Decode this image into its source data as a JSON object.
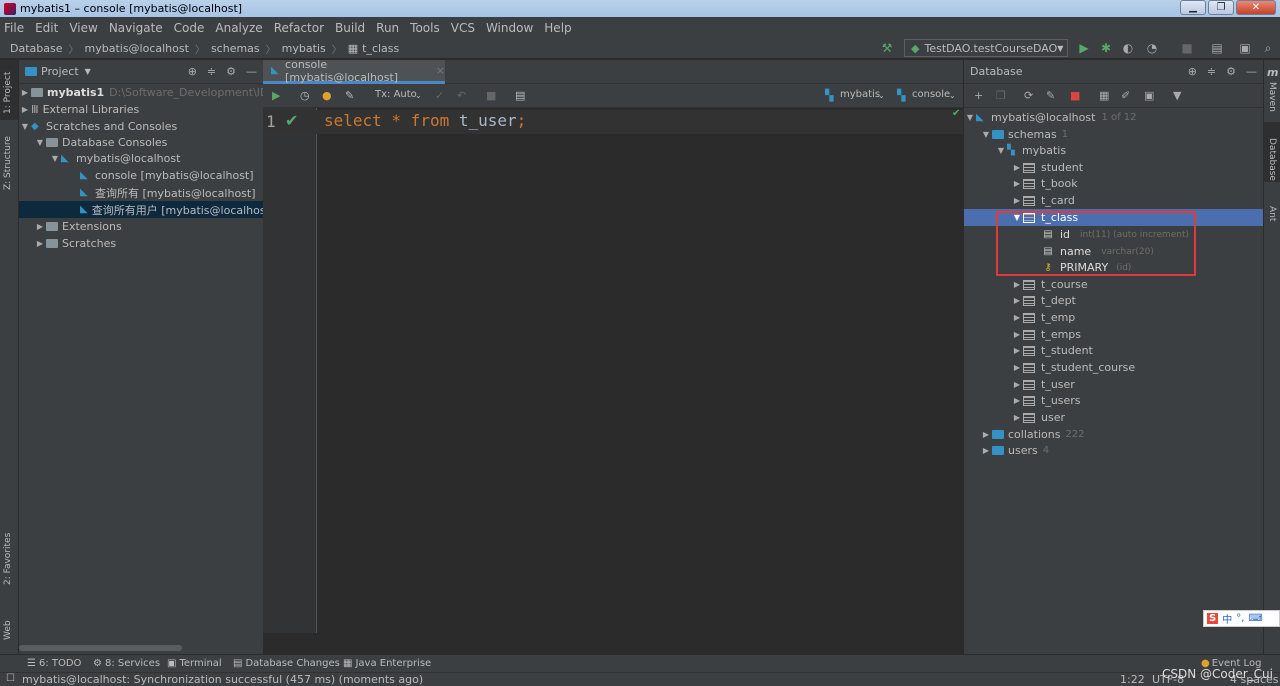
{
  "window": {
    "title": "mybatis1 – console [mybatis@localhost]"
  },
  "menu": [
    "File",
    "Edit",
    "View",
    "Navigate",
    "Code",
    "Analyze",
    "Refactor",
    "Build",
    "Run",
    "Tools",
    "VCS",
    "Window",
    "Help"
  ],
  "breadcrumb": [
    "Database",
    "mybatis@localhost",
    "schemas",
    "mybatis",
    "t_class"
  ],
  "run_config": "TestDAO.testCourseDAO",
  "left_stripe": {
    "project": "1: Project",
    "structure": "Z: Structure",
    "favorites": "2: Favorites",
    "web": "Web"
  },
  "right_stripe": {
    "maven": "Maven",
    "database": "Database",
    "ant": "Ant"
  },
  "project": {
    "header": "Project",
    "root_name": "mybatis1",
    "root_path": "D:\\Software_Development\\IDEA_",
    "external_libraries": "External Libraries",
    "scratches_consoles": "Scratches and Consoles",
    "database_consoles": "Database Consoles",
    "host": "mybatis@localhost",
    "consoles": [
      "console [mybatis@localhost]",
      "查询所有 [mybatis@localhost]",
      "查询所有用户 [mybatis@localhost]"
    ],
    "extensions": "Extensions",
    "scratches": "Scratches"
  },
  "editor": {
    "tab": "console [mybatis@localhost]",
    "tx_mode": "Tx: Auto",
    "schema_selector": "mybatis",
    "session_selector": "console",
    "line_number": "1",
    "code": {
      "kw1": "select",
      "star": " * ",
      "kw2": "from",
      "table": " t_user",
      "semi": ";"
    }
  },
  "database": {
    "header": "Database",
    "host": "mybatis@localhost",
    "host_count": "1 of 12",
    "schemas": "schemas",
    "schemas_count": "1",
    "schema": "mybatis",
    "tables_before": [
      "student",
      "t_book",
      "t_card"
    ],
    "selected_table": "t_class",
    "columns": [
      {
        "name": "id",
        "type": "int(11) (auto increment)"
      },
      {
        "name": "name",
        "type": "varchar(20)"
      }
    ],
    "key": {
      "name": "PRIMARY",
      "type": "(id)"
    },
    "tables_after": [
      "t_course",
      "t_dept",
      "t_emp",
      "t_emps",
      "t_student",
      "t_student_course",
      "t_user",
      "t_users",
      "user"
    ],
    "collations": "collations",
    "collations_count": "222",
    "users": "users",
    "users_count": "4"
  },
  "bottom_tools": [
    "6: TODO",
    "8: Services",
    "Terminal",
    "Database Changes",
    "Java Enterprise"
  ],
  "event_log": "Event Log",
  "status": {
    "message": "mybatis@localhost: Synchronization successful (457 ms) (moments ago)",
    "position": "1:22",
    "encoding": "UTF-8",
    "indent": "4 spaces",
    "watermark": "CSDN @Coder_Cui"
  },
  "ime": "中"
}
